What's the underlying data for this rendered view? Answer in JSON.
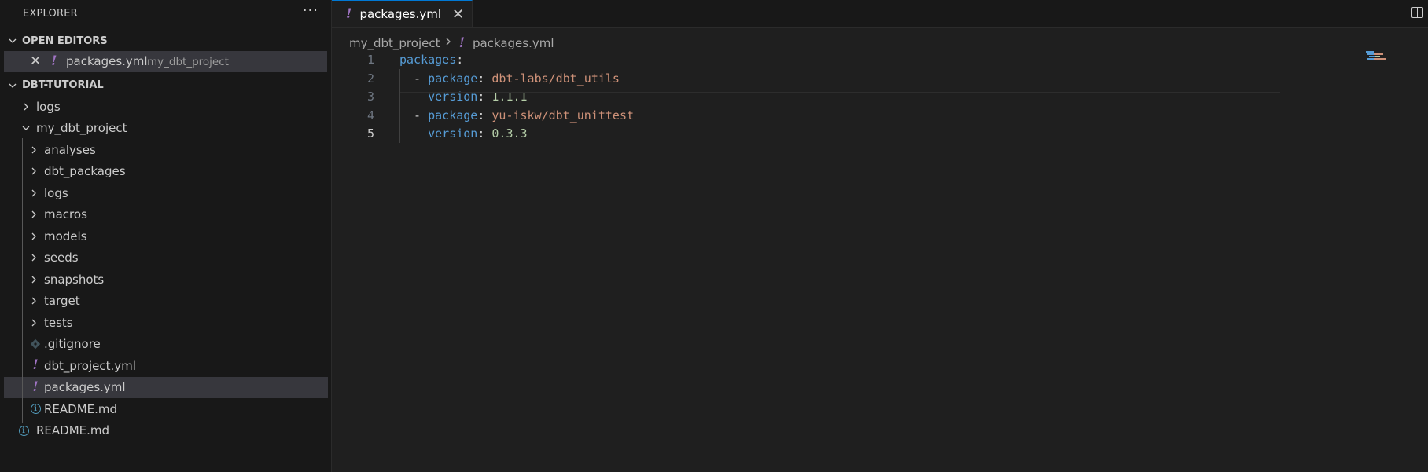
{
  "explorer": {
    "title": "EXPLORER",
    "more_label": "···"
  },
  "open_editors": {
    "section_title": "OPEN EDITORS",
    "items": [
      {
        "name": "packages.yml",
        "description": "my_dbt_project"
      }
    ]
  },
  "workspace": {
    "section_title": "DBT-TUTORIAL",
    "items": [
      {
        "label": "logs",
        "type": "folder",
        "expanded": false,
        "depth": 1
      },
      {
        "label": "my_dbt_project",
        "type": "folder",
        "expanded": true,
        "depth": 1
      },
      {
        "label": "analyses",
        "type": "folder",
        "expanded": false,
        "depth": 2
      },
      {
        "label": "dbt_packages",
        "type": "folder",
        "expanded": false,
        "depth": 2
      },
      {
        "label": "logs",
        "type": "folder",
        "expanded": false,
        "depth": 2
      },
      {
        "label": "macros",
        "type": "folder",
        "expanded": false,
        "depth": 2
      },
      {
        "label": "models",
        "type": "folder",
        "expanded": false,
        "depth": 2
      },
      {
        "label": "seeds",
        "type": "folder",
        "expanded": false,
        "depth": 2
      },
      {
        "label": "snapshots",
        "type": "folder",
        "expanded": false,
        "depth": 2
      },
      {
        "label": "target",
        "type": "folder",
        "expanded": false,
        "depth": 2
      },
      {
        "label": "tests",
        "type": "folder",
        "expanded": false,
        "depth": 2
      },
      {
        "label": ".gitignore",
        "type": "git-file",
        "depth": 2
      },
      {
        "label": "dbt_project.yml",
        "type": "yaml-file",
        "depth": 2
      },
      {
        "label": "packages.yml",
        "type": "yaml-file",
        "depth": 2,
        "selected": true
      },
      {
        "label": "README.md",
        "type": "info-file",
        "depth": 2
      },
      {
        "label": "README.md",
        "type": "info-file",
        "depth": 1
      }
    ]
  },
  "editor": {
    "tab": {
      "label": "packages.yml",
      "active": true
    },
    "breadcrumb": {
      "folder": "my_dbt_project",
      "file": "packages.yml"
    },
    "lines": [
      {
        "n": "1",
        "tokens": [
          {
            "t": "packages",
            "c": "key"
          },
          {
            "t": ":",
            "c": "pun"
          }
        ]
      },
      {
        "n": "2",
        "tokens": [
          {
            "t": "  - ",
            "c": "pun"
          },
          {
            "t": "package",
            "c": "key"
          },
          {
            "t": ": ",
            "c": "pun"
          },
          {
            "t": "dbt-labs/dbt_utils",
            "c": "str"
          }
        ]
      },
      {
        "n": "3",
        "tokens": [
          {
            "t": "    ",
            "c": "pun"
          },
          {
            "t": "version",
            "c": "key"
          },
          {
            "t": ": ",
            "c": "pun"
          },
          {
            "t": "1.1.1",
            "c": "num"
          }
        ]
      },
      {
        "n": "4",
        "tokens": [
          {
            "t": "  - ",
            "c": "pun"
          },
          {
            "t": "package",
            "c": "key"
          },
          {
            "t": ": ",
            "c": "pun"
          },
          {
            "t": "yu-iskw/dbt_unittest",
            "c": "str"
          }
        ]
      },
      {
        "n": "5",
        "tokens": [
          {
            "t": "    ",
            "c": "pun"
          },
          {
            "t": "version",
            "c": "key"
          },
          {
            "t": ": ",
            "c": "pun"
          },
          {
            "t": "0.3.3",
            "c": "num"
          }
        ],
        "current": true
      }
    ]
  },
  "colors": {
    "yaml_icon": "#a074c4",
    "info_icon": "#519aba",
    "git_icon": "#41535b",
    "key": "#569cd6",
    "string": "#ce9178",
    "number": "#b5cea8"
  }
}
